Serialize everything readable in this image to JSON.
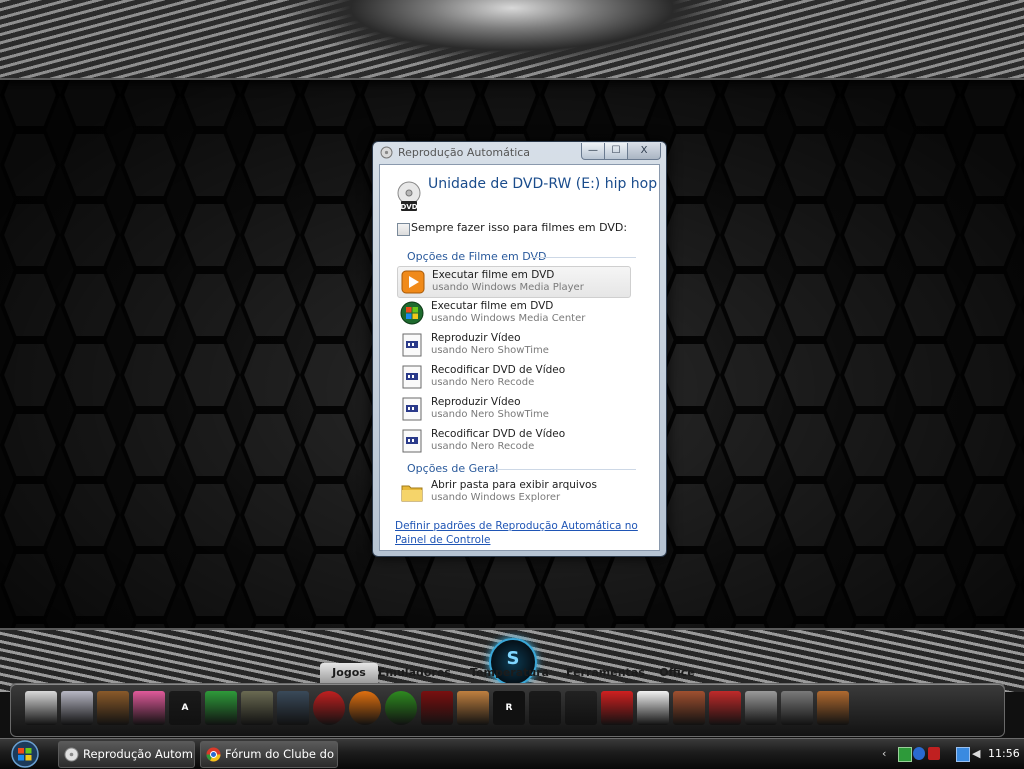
{
  "dialog": {
    "title": "Reprodução Automática",
    "controls": {
      "minimize": "—",
      "maximize": "☐",
      "close": "X"
    },
    "heading": "Unidade de DVD-RW (E:) hip hop",
    "dvd_icon_text": "DVD",
    "checkbox_label": "Sempre fazer isso para filmes em DVD:",
    "checkbox_checked": false,
    "section_movie": "Opções de Filme em DVD",
    "options": [
      {
        "title": "Executar filme em DVD",
        "subtitle": "usando Windows Media Player",
        "icon": "windows-media-player-icon"
      },
      {
        "title": "Executar filme em DVD",
        "subtitle": "usando Windows Media Center",
        "icon": "windows-media-center-icon"
      },
      {
        "title": "Reproduzir Vídeo",
        "subtitle": "usando Nero ShowTime",
        "icon": "nero-document-icon"
      },
      {
        "title": "Recodificar DVD de Vídeo",
        "subtitle": "usando Nero Recode",
        "icon": "nero-document-icon"
      },
      {
        "title": "Reproduzir Vídeo",
        "subtitle": "usando Nero ShowTime",
        "icon": "nero-document-icon"
      },
      {
        "title": "Recodificar DVD de Vídeo",
        "subtitle": "usando Nero Recode",
        "icon": "nero-document-icon"
      }
    ],
    "section_general": "Opções de Geral",
    "general_option": {
      "title": "Abrir pasta para exibir arquivos",
      "subtitle": "usando Windows Explorer",
      "icon": "folder-icon"
    },
    "footer_link": "Definir padrões de Reprodução Automática no Painel de Controle"
  },
  "dock": {
    "badge": "S",
    "tabs": [
      "Jogos",
      "Emuladores",
      "Temperatura",
      "Ferramentas",
      "Office"
    ],
    "active_tab": "Jogos",
    "icons": [
      {
        "name": "assassins-creed-icon",
        "text": "",
        "color": "#d9d9d9"
      },
      {
        "name": "robot-icon",
        "text": "",
        "color": "#b7b7c4"
      },
      {
        "name": "soldier-icon",
        "text": "",
        "color": "#8a5a2a"
      },
      {
        "name": "racing-icon",
        "text": "",
        "color": "#e05a9a"
      },
      {
        "name": "arma-icon",
        "text": "A",
        "color": "#1a1a1a"
      },
      {
        "name": "sims-icon",
        "text": "",
        "color": "#2e9a3a"
      },
      {
        "name": "splinter-cell-icon",
        "text": "",
        "color": "#6a6a52"
      },
      {
        "name": "call-of-duty-icon",
        "text": "",
        "color": "#3a4a5a"
      },
      {
        "name": "burnout-icon",
        "text": "",
        "color": "#c02020"
      },
      {
        "name": "target-icon",
        "text": "",
        "color": "#e07010"
      },
      {
        "name": "eye-icon",
        "text": "",
        "color": "#2e8a20"
      },
      {
        "name": "gears-of-war-icon",
        "text": "",
        "color": "#7a1010"
      },
      {
        "name": "fighter-icon",
        "text": "",
        "color": "#c08040"
      },
      {
        "name": "rockstar-icon",
        "text": "R",
        "color": "#111111"
      },
      {
        "name": "hat-icon",
        "text": "",
        "color": "#1a1a1a"
      },
      {
        "name": "kane-lynch-icon",
        "text": "",
        "color": "#222222"
      },
      {
        "name": "mirrors-edge-icon",
        "text": "",
        "color": "#d02020"
      },
      {
        "name": "f1-icon",
        "text": "",
        "color": "#f2f2f2"
      },
      {
        "name": "character-icon",
        "text": "",
        "color": "#a05030"
      },
      {
        "name": "moto-icon",
        "text": "",
        "color": "#c02a2a"
      },
      {
        "name": "wolf-icon",
        "text": "",
        "color": "#9a9a9a"
      },
      {
        "name": "stranglehold-icon",
        "text": "",
        "color": "#7a7a7a"
      },
      {
        "name": "fighter2-icon",
        "text": "",
        "color": "#b06a30"
      }
    ]
  },
  "taskbar": {
    "buttons": [
      {
        "label": "Reprodução Autom...",
        "icon": "autoplay-icon"
      },
      {
        "label": "Fórum do Clube do ...",
        "icon": "chrome-icon"
      }
    ],
    "clock": "11:56"
  }
}
